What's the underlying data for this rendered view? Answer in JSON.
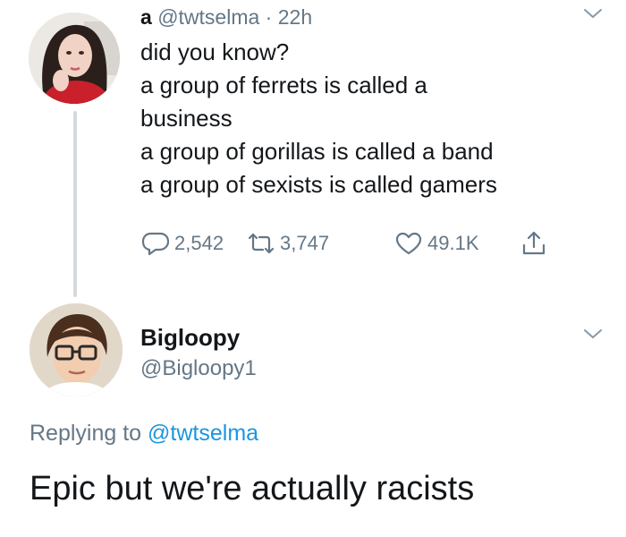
{
  "tweet": {
    "author_name": "a",
    "handle": "@twtselma",
    "separator": "·",
    "time": "22h",
    "lines": [
      "did you know?",
      "a group of ferrets is called a",
      "business",
      "a group of gorillas is called a band",
      "a group of sexists is called gamers"
    ],
    "actions": {
      "replies": "2,542",
      "retweets": "3,747",
      "likes": "49.1K"
    },
    "icons": {
      "avatar": "woman-avatar-icon",
      "menu": "chevron-down-icon",
      "reply": "speech-bubble-icon",
      "retweet": "retweet-arrows-icon",
      "like": "heart-icon",
      "share": "share-upload-icon"
    }
  },
  "reply": {
    "author_name": "Bigloopy",
    "handle": "@Bigloopy1",
    "replying_prefix": "Replying to",
    "replying_to": "@twtselma",
    "text": "Epic but we're actually racists",
    "icons": {
      "avatar": "boy-with-glasses-avatar-icon",
      "menu": "chevron-down-icon"
    }
  },
  "colors": {
    "text": "#14171a",
    "secondary": "#657786",
    "link": "#1b95e0",
    "thread_line": "#d4d9dd"
  }
}
